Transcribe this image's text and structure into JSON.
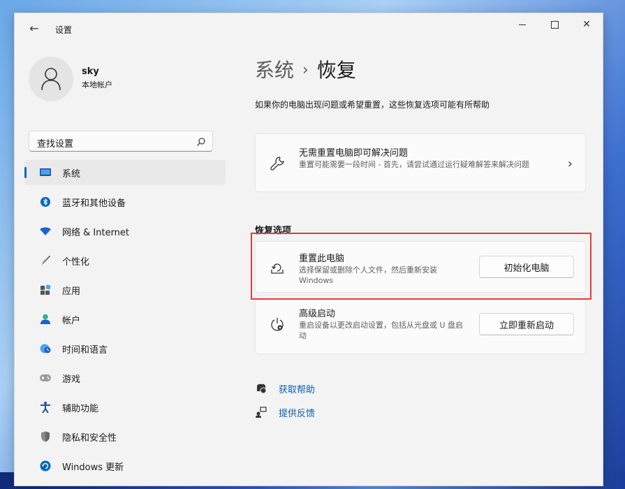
{
  "window": {
    "app_title": "设置"
  },
  "profile": {
    "name": "sky",
    "account_type": "本地帐户"
  },
  "search": {
    "placeholder": "查找设置"
  },
  "sidebar": {
    "items": [
      {
        "label": "系统",
        "icon": "monitor-icon",
        "active": true
      },
      {
        "label": "蓝牙和其他设备",
        "icon": "bluetooth-icon"
      },
      {
        "label": "网络 & Internet",
        "icon": "wifi-icon"
      },
      {
        "label": "个性化",
        "icon": "brush-icon"
      },
      {
        "label": "应用",
        "icon": "apps-icon"
      },
      {
        "label": "帐户",
        "icon": "account-icon"
      },
      {
        "label": "时间和语言",
        "icon": "globe-clock-icon"
      },
      {
        "label": "游戏",
        "icon": "gamepad-icon"
      },
      {
        "label": "辅助功能",
        "icon": "accessibility-icon"
      },
      {
        "label": "隐私和安全性",
        "icon": "shield-icon"
      },
      {
        "label": "Windows 更新",
        "icon": "update-icon"
      }
    ]
  },
  "main": {
    "breadcrumb_parent": "系统",
    "breadcrumb_separator": "›",
    "breadcrumb_current": "恢复",
    "subtitle": "如果你的电脑出现问题或希望重置，这些恢复选项可能有所帮助",
    "fix_card": {
      "title": "无需重置电脑即可解决问题",
      "description": "重置可能需要一段时间 - 首先，请尝试通过运行疑难解答来解决问题"
    },
    "section_title": "恢复选项",
    "reset_card": {
      "title": "重置此电脑",
      "description": "选择保留或删除个人文件，然后重新安装 Windows",
      "button": "初始化电脑"
    },
    "advanced_card": {
      "title": "高级启动",
      "description": "重启设备以更改启动设置，包括从光盘或 U 盘启动",
      "button": "立即重新启动"
    },
    "links": {
      "help": "获取帮助",
      "feedback": "提供反馈"
    }
  },
  "colors": {
    "accent": "#0067c0",
    "highlight_border": "#e5393b",
    "link": "#0a5fb4"
  }
}
